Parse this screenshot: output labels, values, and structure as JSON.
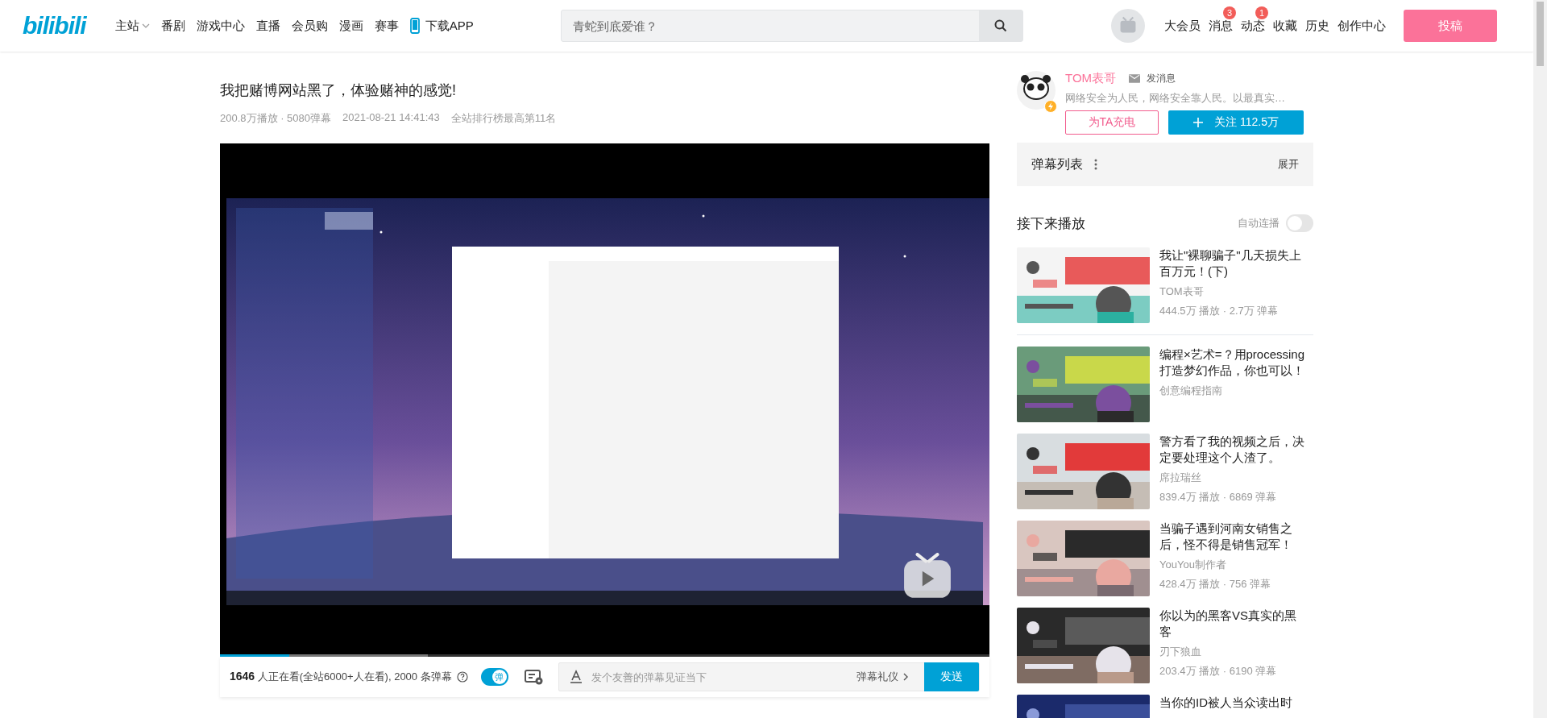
{
  "header": {
    "logo": "bilibili",
    "nav": [
      {
        "label": "主站",
        "dropdown": true
      },
      {
        "label": "番剧",
        "dropdown": false
      },
      {
        "label": "游戏中心",
        "dropdown": false
      },
      {
        "label": "直播",
        "dropdown": false
      },
      {
        "label": "会员购",
        "dropdown": false
      },
      {
        "label": "漫画",
        "dropdown": false
      },
      {
        "label": "赛事",
        "dropdown": false
      }
    ],
    "app_link": "下载APP",
    "search": {
      "placeholder": "青蛇到底爱谁？"
    },
    "user_links": [
      {
        "label": "大会员"
      },
      {
        "label": "消息",
        "badge": "3"
      },
      {
        "label": "动态",
        "badge": "1"
      },
      {
        "label": "收藏"
      },
      {
        "label": "历史"
      },
      {
        "label": "创作中心"
      }
    ],
    "upload_button": "投稿"
  },
  "video": {
    "title": "我把赌博网站黑了，体验赌神的感觉!",
    "plays": "200.8万播放 · 5080弹幕",
    "date": "2021-08-21 14:41:43",
    "rank": "全站排行榜最高第11名",
    "progress": {
      "level": 0.09
    },
    "buffer": {
      "level": 0.27
    }
  },
  "danmaku_bar": {
    "viewers": "**1646** 人正在看(全站6000+人在看), 2000 条弹幕",
    "danmaku_on": true,
    "toggle_label": "弹",
    "input": {
      "placeholder": "发个友善的弹幕见证当下"
    },
    "etiquette": "弹幕礼仪",
    "send": "发送"
  },
  "author": {
    "name": "TOM表哥",
    "message": "发消息",
    "bio": "网络安全为人民，网络安全靠人民。以最真实…",
    "charge": "为TA充电",
    "follow": "关注 112.5万"
  },
  "danmaku_list": {
    "title": "弹幕列表",
    "expand": "展开"
  },
  "up_next": {
    "title": "接下来播放",
    "autoplay_label": "自动连播",
    "autoplay": false,
    "videos": [
      {
        "title": "我让\"裸聊骗子\"几天损失上百万元！(下)",
        "author": "TOM表哥",
        "stats": "444.5万 播放 · 2.7万 弹幕"
      },
      {
        "title": "编程×艺术=？用processing打造梦幻作品，你也可以！",
        "author": "创意编程指南"
      },
      {
        "title": "警方看了我的视频之后，决定要处理这个人渣了。",
        "author": "席拉瑞丝",
        "stats": "839.4万 播放 · 6869 弹幕"
      },
      {
        "title": "当骗子遇到河南女销售之后，怪不得是销售冠军！",
        "author": "YouYou制作者",
        "stats": "428.4万 播放 · 756 弹幕"
      },
      {
        "title": "你以为的黑客VS真实的黑客",
        "author": "刃下狼血",
        "stats": "203.4万 播放 · 6190 弹幕"
      },
      {
        "title": "当你的ID被人当众读出时"
      }
    ]
  }
}
